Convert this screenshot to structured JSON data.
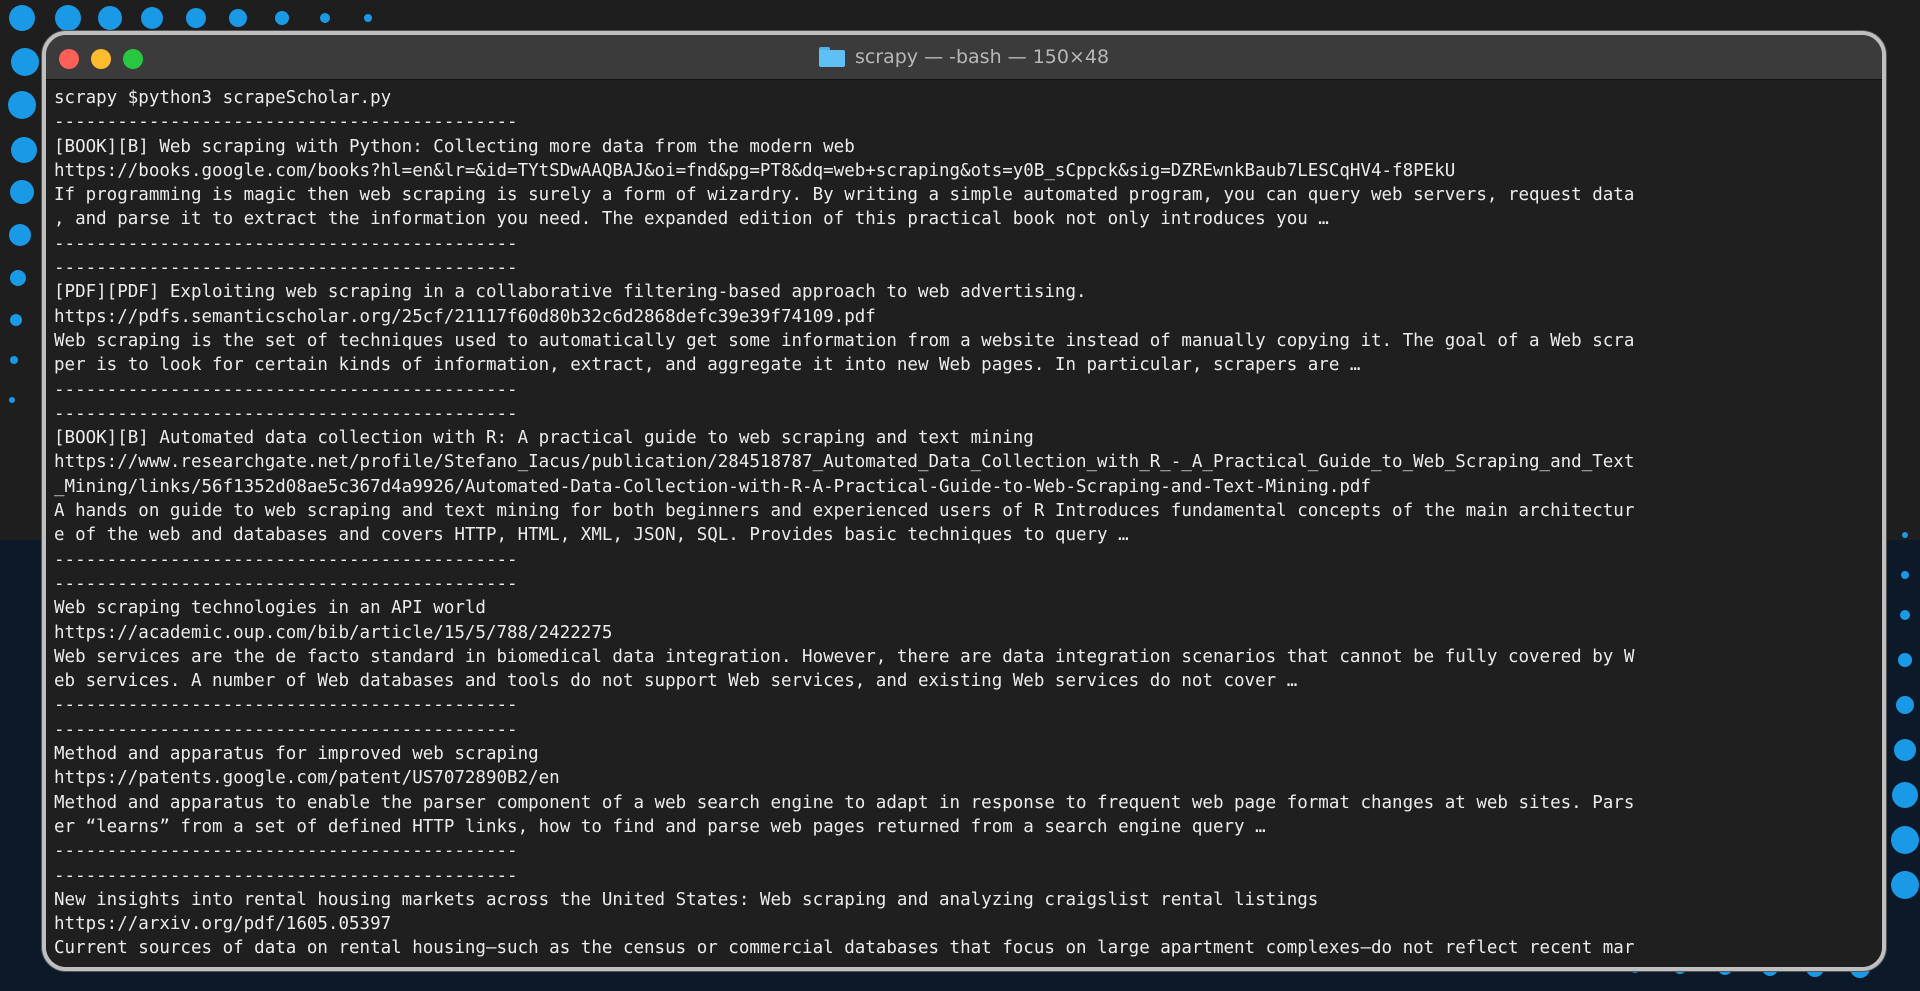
{
  "window": {
    "title": "scrapy — -bash — 150×48",
    "folder_icon": "folder-icon",
    "buttons": [
      "close-button",
      "minimize-button",
      "zoom-button"
    ]
  },
  "terminal": {
    "lines": [
      "scrapy $python3 scrapeScholar.py",
      "--------------------------------------------",
      "[BOOK][B] Web scraping with Python: Collecting more data from the modern web",
      "https://books.google.com/books?hl=en&lr=&id=TYtSDwAAQBAJ&oi=fnd&pg=PT8&dq=web+scraping&ots=y0B_sCppck&sig=DZREwnkBaub7LESCqHV4-f8PEkU",
      "If programming is magic then web scraping is surely a form of wizardry. By writing a simple automated program, you can query web servers, request data",
      ", and parse it to extract the information you need. The expanded edition of this practical book not only introduces you …",
      "--------------------------------------------",
      "--------------------------------------------",
      "[PDF][PDF] Exploiting web scraping in a collaborative filtering-based approach to web advertising.",
      "https://pdfs.semanticscholar.org/25cf/21117f60d80b32c6d2868defc39e39f74109.pdf",
      "Web scraping is the set of techniques used to automatically get some information from a website instead of manually copying it. The goal of a Web scra",
      "per is to look for certain kinds of information, extract, and aggregate it into new Web pages. In particular, scrapers are …",
      "--------------------------------------------",
      "--------------------------------------------",
      "[BOOK][B] Automated data collection with R: A practical guide to web scraping and text mining",
      "https://www.researchgate.net/profile/Stefano_Iacus/publication/284518787_Automated_Data_Collection_with_R_-_A_Practical_Guide_to_Web_Scraping_and_Text",
      "_Mining/links/56f1352d08ae5c367d4a9926/Automated-Data-Collection-with-R-A-Practical-Guide-to-Web-Scraping-and-Text-Mining.pdf",
      "A hands on guide to web scraping and text mining for both beginners and experienced users of R Introduces fundamental concepts of the main architectur",
      "e of the web and databases and covers HTTP, HTML, XML, JSON, SQL. Provides basic techniques to query …",
      "--------------------------------------------",
      "--------------------------------------------",
      "Web scraping technologies in an API world",
      "https://academic.oup.com/bib/article/15/5/788/2422275",
      "Web services are the de facto standard in biomedical data integration. However, there are data integration scenarios that cannot be fully covered by W",
      "eb services. A number of Web databases and tools do not support Web services, and existing Web services do not cover …",
      "--------------------------------------------",
      "--------------------------------------------",
      "Method and apparatus for improved web scraping",
      "https://patents.google.com/patent/US7072890B2/en",
      "Method and apparatus to enable the parser component of a web search engine to adapt in response to frequent web page format changes at web sites. Pars",
      "er “learns” from a set of defined HTTP links, how to find and parse web pages returned from a search engine query …",
      "--------------------------------------------",
      "--------------------------------------------",
      "New insights into rental housing markets across the United States: Web scraping and analyzing craigslist rental listings",
      "https://arxiv.org/pdf/1605.05397",
      "Current sources of data on rental housing—such as the census or commercial databases that focus on large apartment complexes—do not reflect recent mar"
    ]
  },
  "colors": {
    "terminal_bg": "#1f1f1f",
    "terminal_text": "#ececec",
    "titlebar_bg": "#3b3b3b",
    "dot_blue": "#1a9ae6",
    "close": "#fe5f57",
    "minimize": "#febc2e",
    "zoom": "#28c840"
  }
}
